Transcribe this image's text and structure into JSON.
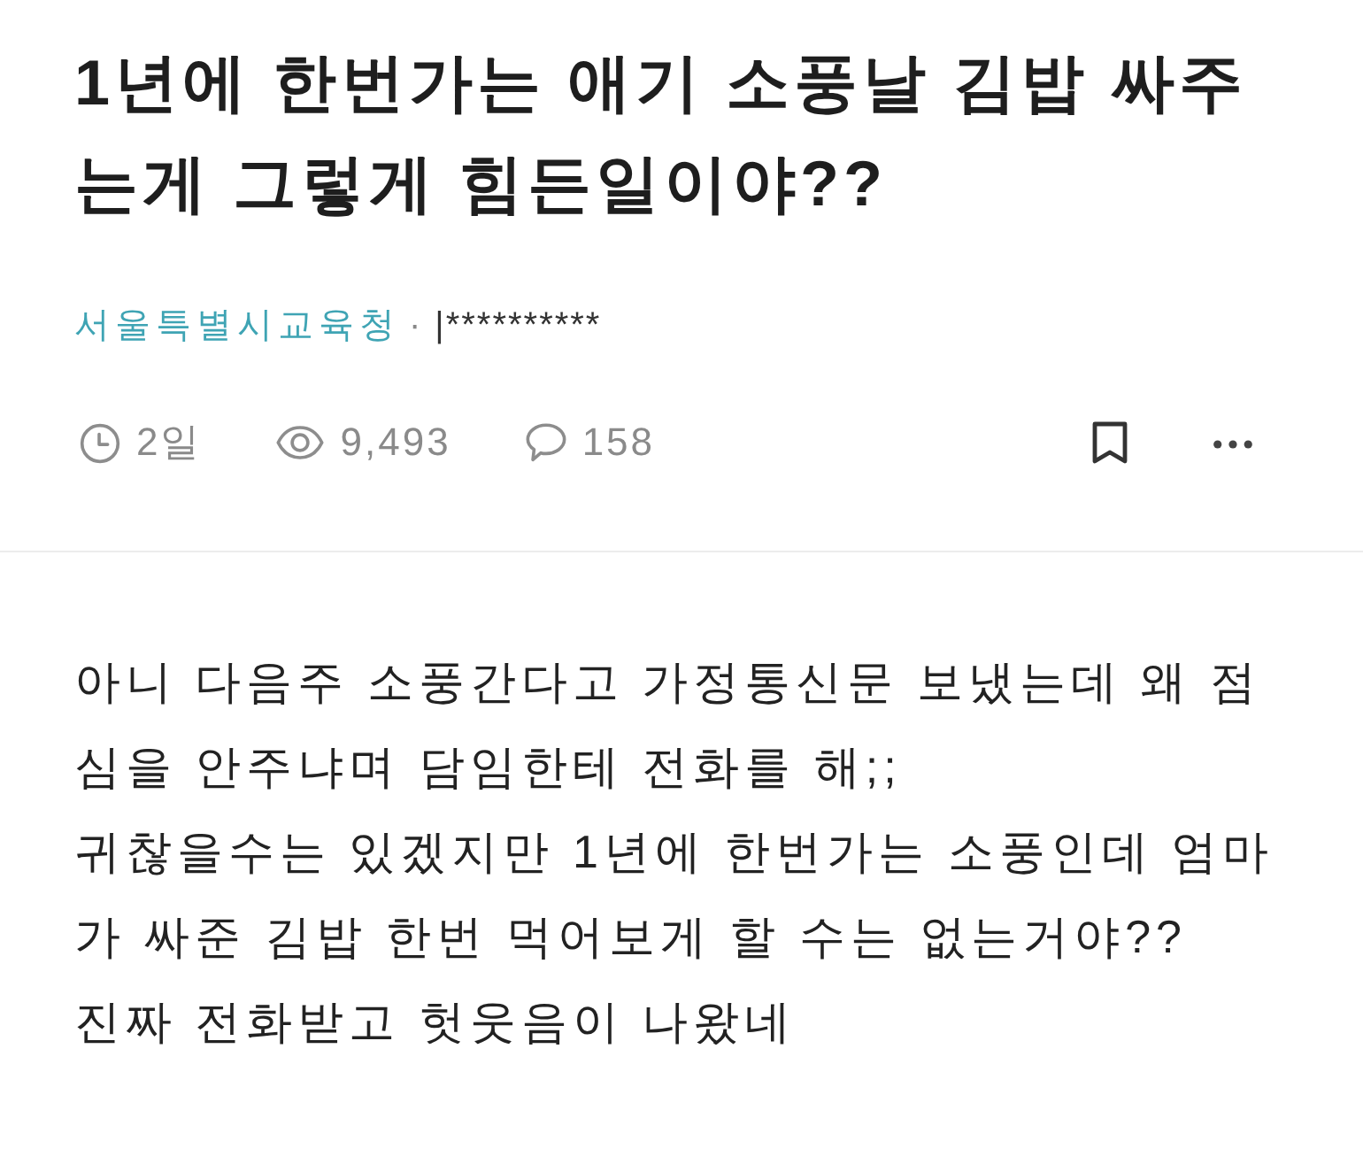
{
  "post": {
    "title": "1년에 한번가는 애기 소풍날 김밥 싸주는게 그렇게 힘든일이야??",
    "board": "서울특별시교육청",
    "separator": "·",
    "author": "|**********"
  },
  "stats": {
    "age": "2일",
    "views": "9,493",
    "comments": "158"
  },
  "body": [
    "아니 다음주 소풍간다고 가정통신문 보냈는데 왜 점심을 안주냐며 담임한테 전화를 해;;",
    "귀찮을수는 있겠지만 1년에 한번가는 소풍인데 엄마가 싸준 김밥 한번 먹어보게 할 수는 없는거야??",
    "진짜 전화받고 헛웃음이 나왔네"
  ]
}
